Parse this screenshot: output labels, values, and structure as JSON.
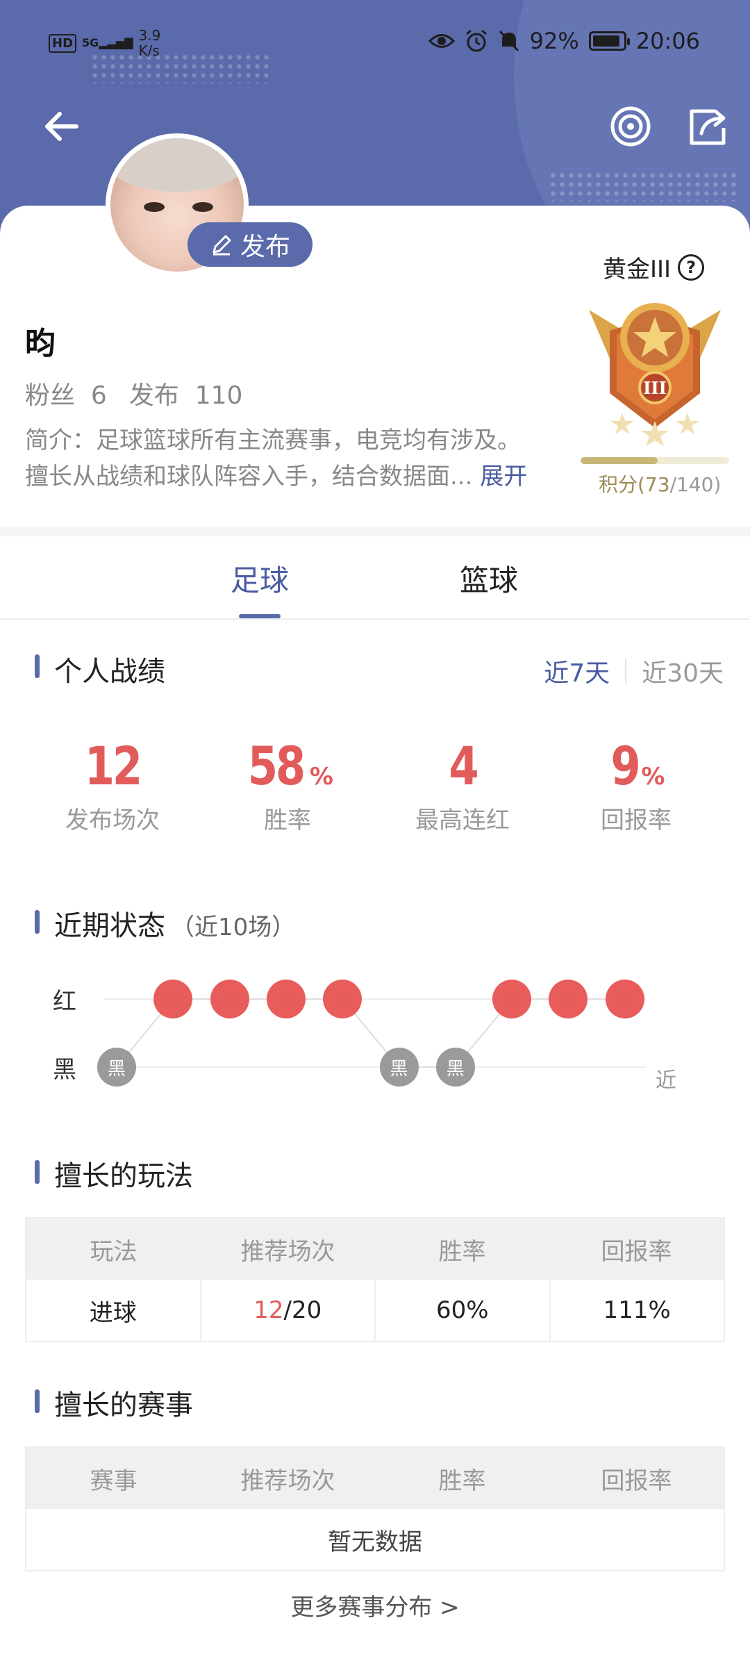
{
  "status_bar": {
    "network": "5G",
    "speed_value": "3.9",
    "speed_unit": "K/s",
    "battery": "92%",
    "battery_level": 0.92,
    "time": "20:06"
  },
  "profile": {
    "publish_label": "发布",
    "username": "昀",
    "fans_label": "粉丝",
    "fans_count": "6",
    "posts_label": "发布",
    "posts_count": "110",
    "bio_line1": "简介：足球篮球所有主流赛事，电竞均有涉及。",
    "bio_line2": "擅长从战绩和球队阵容入手，结合数据面...",
    "bio_more": "展开"
  },
  "rank": {
    "name": "黄金III",
    "help_icon": "question-icon",
    "medal_icon": "gold-medal-icon",
    "points_label": "积分(73",
    "points_max": "/140)",
    "progress": 0.52
  },
  "tabs": [
    {
      "label": "足球",
      "active": true
    },
    {
      "label": "篮球",
      "active": false
    }
  ],
  "record": {
    "title": "个人战绩",
    "period_7": "近7天",
    "period_30": "近30天",
    "metrics": [
      {
        "value": "12",
        "unit": "",
        "label": "发布场次"
      },
      {
        "value": "58",
        "unit": "%",
        "label": "胜率"
      },
      {
        "value": "4",
        "unit": "",
        "label": "最高连红"
      },
      {
        "value": "9",
        "unit": "%",
        "label": "回报率"
      }
    ]
  },
  "recent": {
    "title": "近期状态",
    "subtitle": "（近10场）",
    "row_red": "红",
    "row_black": "黑",
    "axis_end": "近",
    "results": [
      "黑",
      "红",
      "红",
      "红",
      "红",
      "黑",
      "黑",
      "红",
      "红",
      "红"
    ],
    "red_text": "红",
    "black_text": "黑"
  },
  "play_style": {
    "title": "擅长的玩法",
    "headers": [
      "玩法",
      "推荐场次",
      "胜率",
      "回报率"
    ],
    "row": {
      "play": "进球",
      "hits": "12",
      "total": "/20",
      "win_rate": "60%",
      "return": "111%"
    }
  },
  "events": {
    "title": "擅长的赛事",
    "headers": [
      "赛事",
      "推荐场次",
      "胜率",
      "回报率"
    ],
    "empty": "暂无数据",
    "more": "更多赛事分布 >"
  },
  "colors": {
    "brand": "#5a6aaa",
    "red": "#e25b5b",
    "gold": "#c9b77a"
  }
}
